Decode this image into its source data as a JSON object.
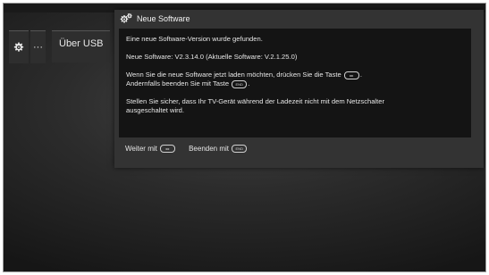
{
  "menu": {
    "gear_icon": "gear-icon",
    "dots_label": "···",
    "usb_label": "Über USB"
  },
  "dialog": {
    "title": "Neue Software",
    "title_icon": "gear-pair-icon",
    "line1": "Eine neue Software-Version wurde gefunden.",
    "line2": "Neue Software:  V2.3.14.0   (Aktuelle Software:  V.2.1.25.0)",
    "line3a": "Wenn Sie die neue Software jetzt laden möchten, drücken Sie die Taste",
    "line3b": ".",
    "line4a": "Andernfalls beenden Sie mit Taste",
    "line4b": ".",
    "line5": "Stellen Sie sicher, dass Ihr TV-Gerät während der Ladezeit nicht mit dem Netzschalter ausgeschaltet wird.",
    "key_forward": "▸▸",
    "key_end": "END",
    "footer_continue": "Weiter mit",
    "footer_end": "Beenden mit"
  }
}
